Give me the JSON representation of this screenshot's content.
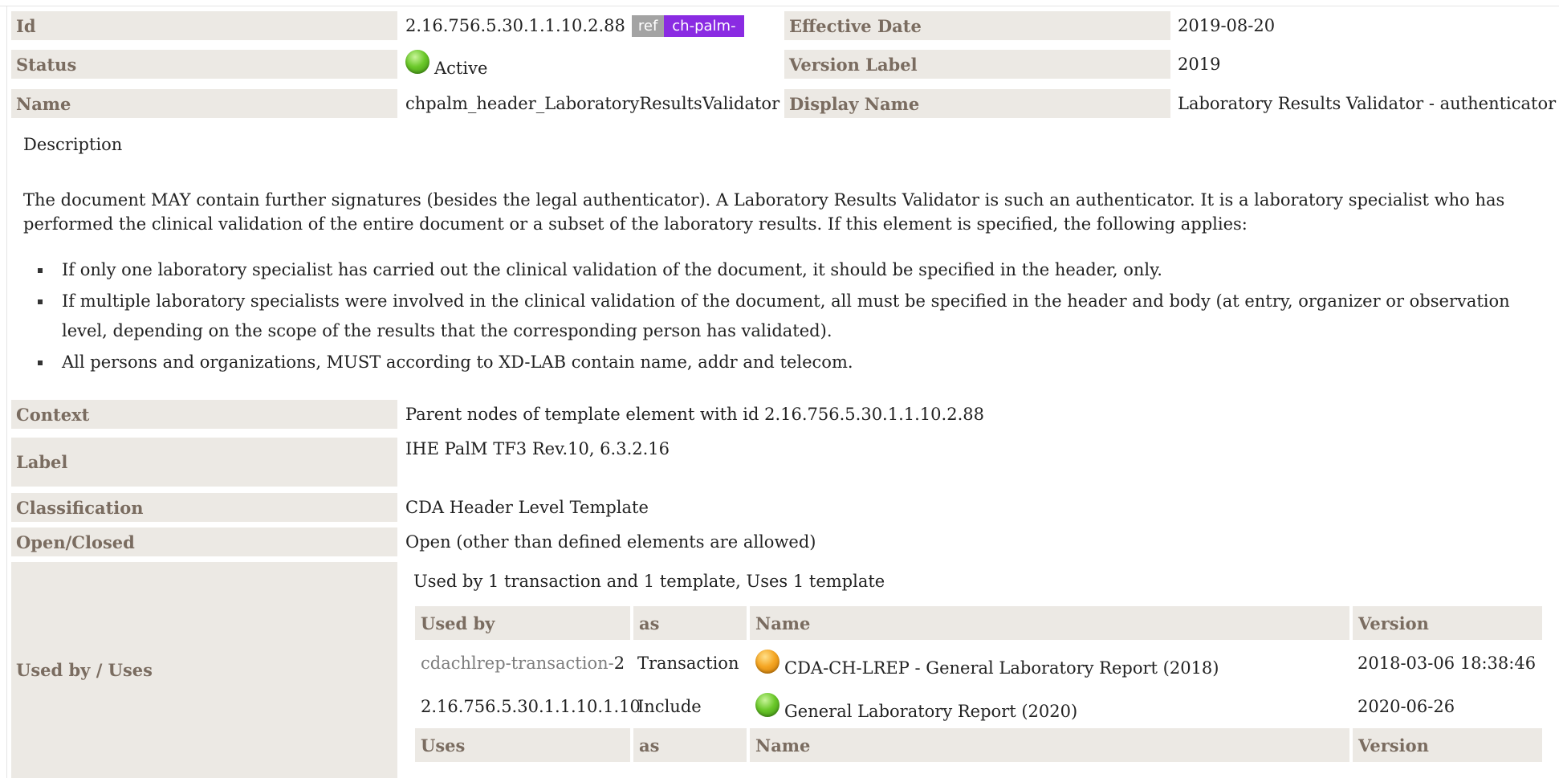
{
  "header": {
    "id_label": "Id",
    "id_value": "2.16.756.5.30.1.1.10.2.88",
    "ref_tag": "ref",
    "prefix_tag": "ch-palm-",
    "effective_date_label": "Effective Date",
    "effective_date_value": "2019-08-20",
    "status_label": "Status",
    "status_value": "Active",
    "version_label_label": "Version Label",
    "version_label_value": "2019",
    "name_label": "Name",
    "name_value": "chpalm_header_LaboratoryResultsValidator",
    "display_name_label": "Display Name",
    "display_name_value": "Laboratory Results Validator - authenticator"
  },
  "description": {
    "title": "Description",
    "paragraph": "The document MAY contain further signatures (besides the legal authenticator). A Laboratory Results Validator is such an authenticator. It is a laboratory specialist who has performed the clinical validation of the entire document or a subset of the laboratory results. If this element is specified, the following applies:",
    "bullets": [
      "If only one laboratory specialist has carried out the clinical validation of the document, it should be specified in the header, only.",
      "If multiple laboratory specialists were involved in the clinical validation of the document, all must be specified in the header and body (at entry, organizer or observation level, depending on the scope of the results that the corresponding person has validated).",
      "All persons and organizations, MUST according to XD-LAB contain name, addr and telecom."
    ]
  },
  "details": {
    "context_label": "Context",
    "context_value": "Parent nodes of template element with id 2.16.756.5.30.1.1.10.2.88",
    "label_label": "Label",
    "label_value": "IHE PalM TF3 Rev.10, 6.3.2.16",
    "classification_label": "Classification",
    "classification_value": "CDA Header Level Template",
    "open_closed_label": "Open/Closed",
    "open_closed_value": "Open (other than defined elements are allowed)",
    "used_by_uses_label": "Used by / Uses"
  },
  "usage": {
    "caption": "Used by 1 transaction and 1 template, Uses 1 template",
    "used_by_headers": [
      "Used by",
      "as",
      "Name",
      "Version"
    ],
    "rows": [
      {
        "ref_prefix": "cdachlrep-transaction-",
        "ref_suffix": "2",
        "as": "Transaction",
        "status": "orange",
        "name": "CDA-CH-LREP - General Laboratory Report (2018)",
        "version": "2018-03-06 18:38:46"
      },
      {
        "ref_prefix": "2.16.756.5.30.1.1.10.1.10",
        "ref_suffix": "",
        "as": "Include",
        "status": "green",
        "name": "General Laboratory Report (2020)",
        "version": "2020-06-26"
      }
    ],
    "uses_headers": [
      "Uses",
      "as",
      "Name",
      "Version"
    ]
  },
  "colors": {
    "label_bg": "#ece9e4",
    "label_text": "#7a6c60",
    "prefix_tag": "#8a2be2",
    "ref_tag": "#a3a3a3",
    "active_green": "#6bc82a",
    "draft_orange": "#f5a623"
  },
  "icons": {
    "status_active": "green-status-dot-icon",
    "status_draft": "orange-status-dot-icon"
  }
}
